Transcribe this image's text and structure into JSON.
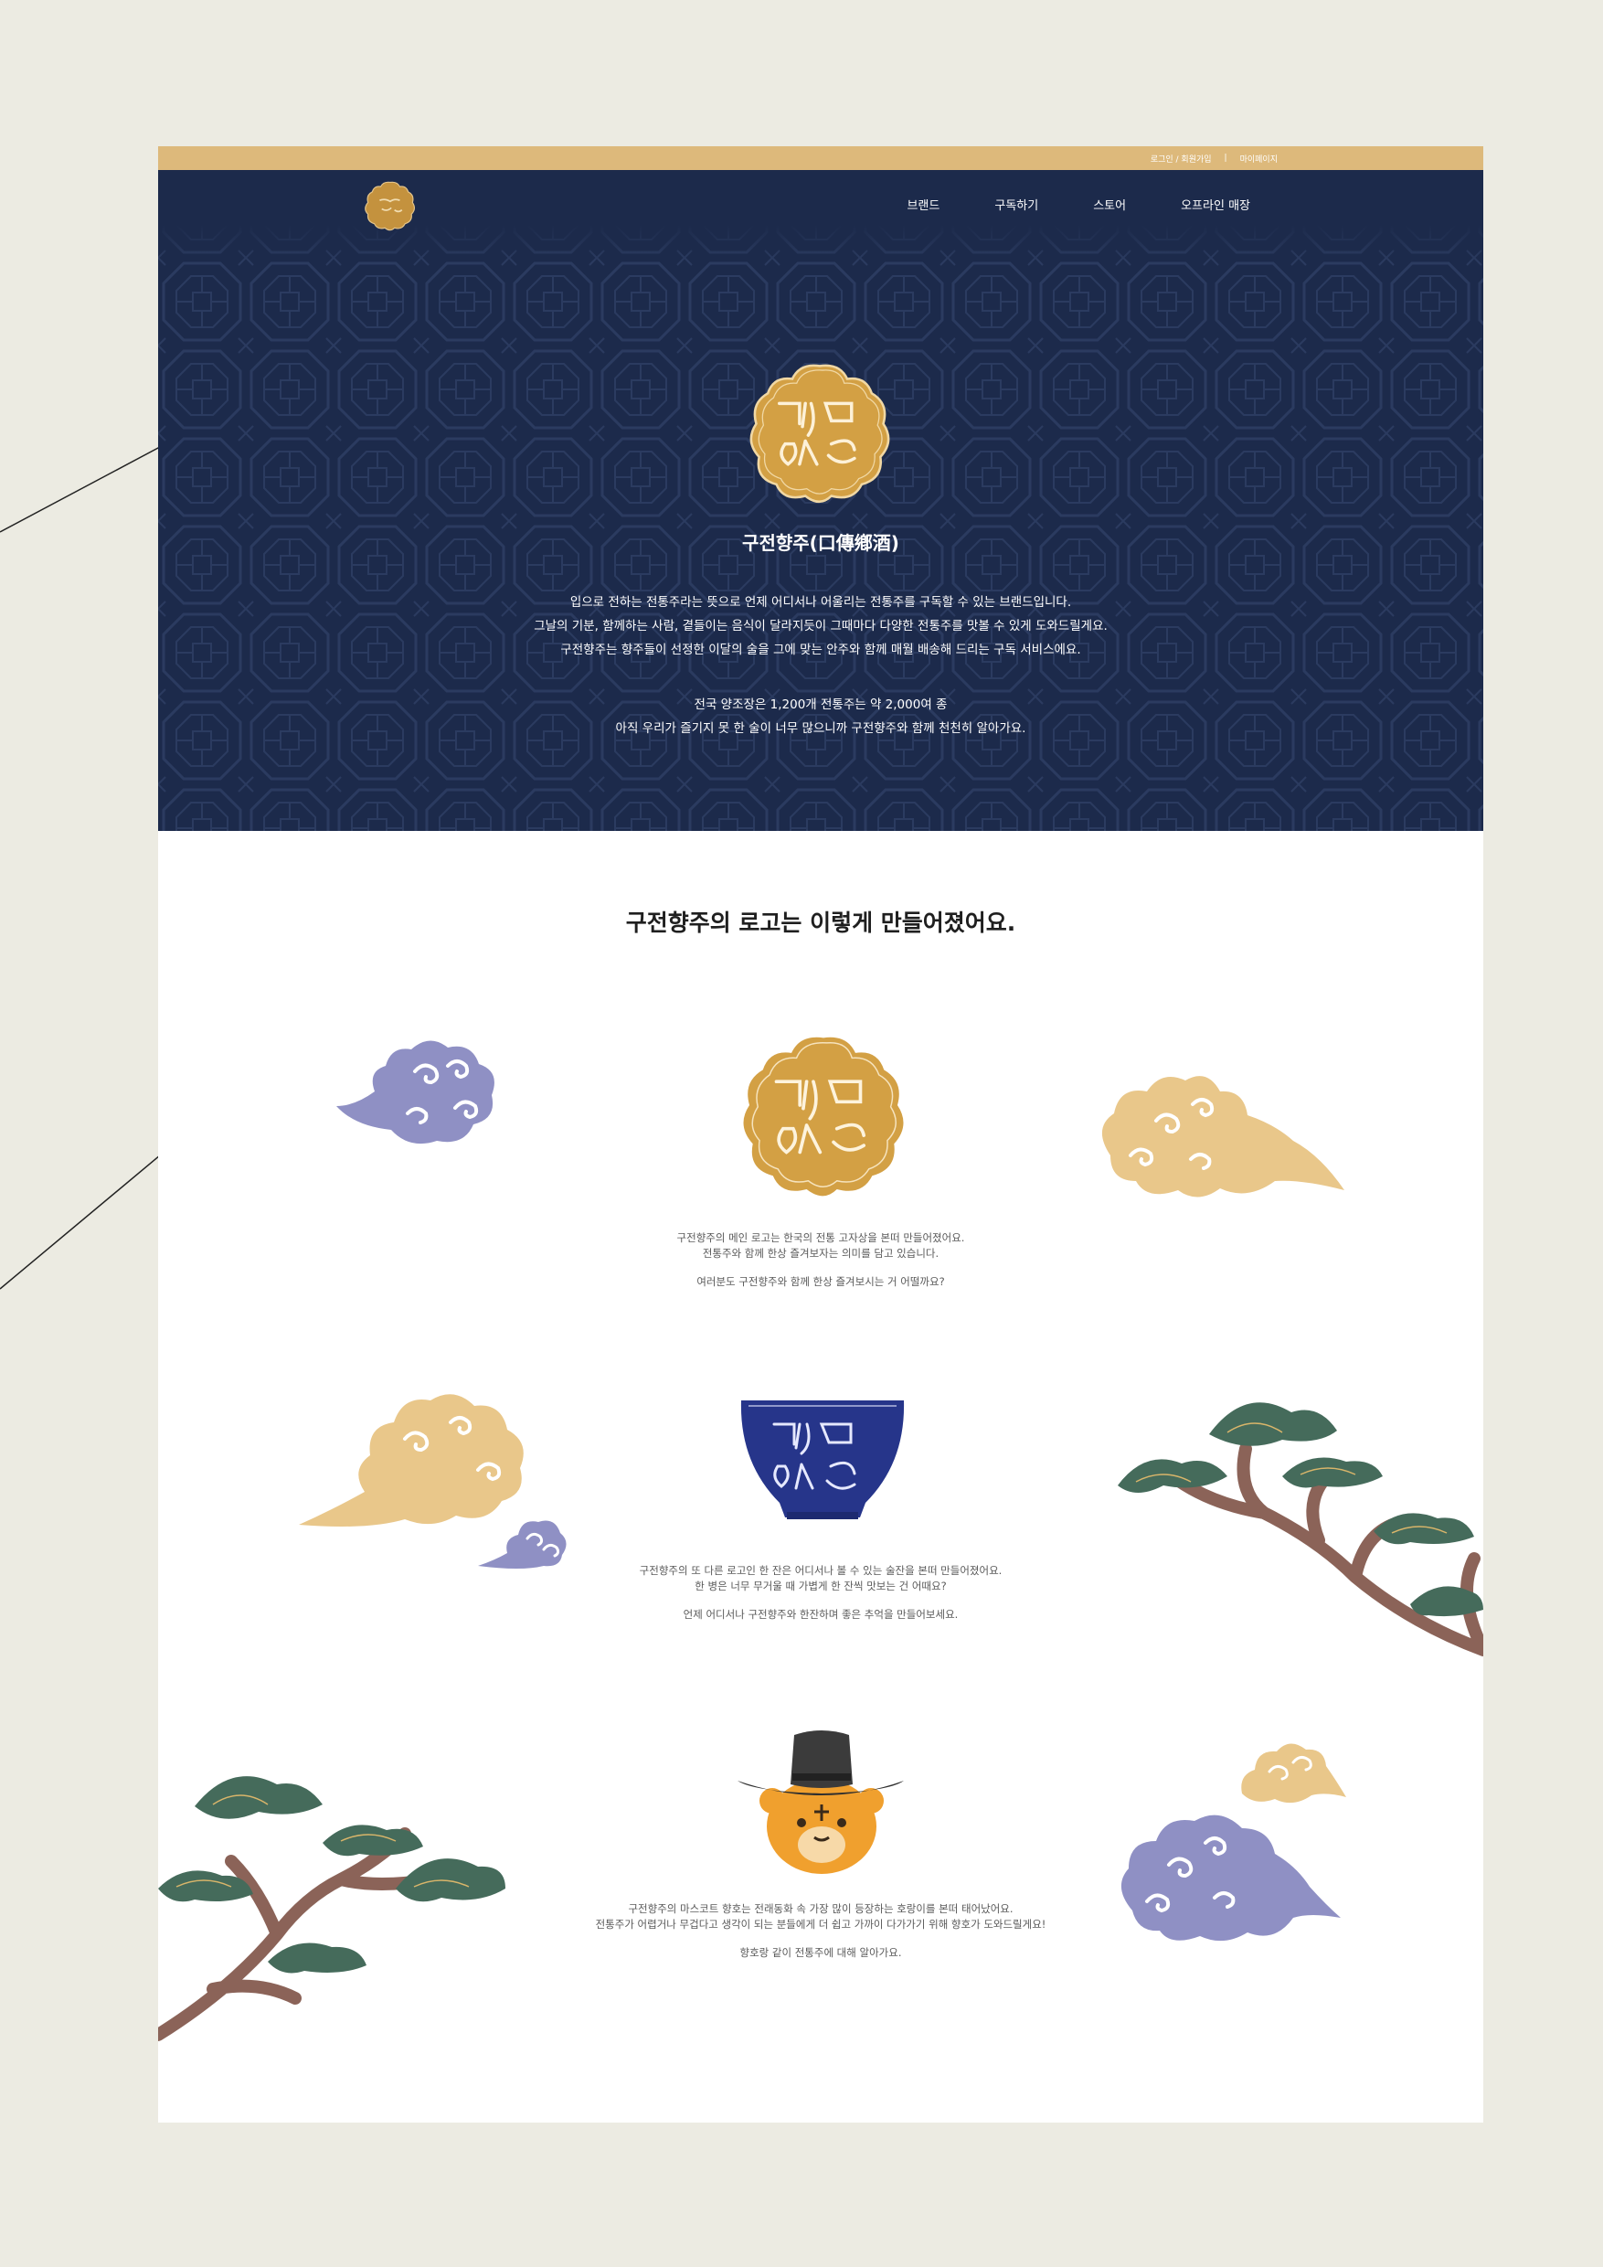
{
  "topbar": {
    "login": "로그인 / 회원가입",
    "separator": "|",
    "mypage": "마이페이지"
  },
  "nav": {
    "items": [
      "브랜드",
      "구독하기",
      "스토어",
      "오프라인 매장"
    ]
  },
  "hero": {
    "title": "구전향주(口傳鄕酒)",
    "desc1": "입으로 전하는 전통주라는 뜻으로 언제 어디서나 어울리는 전통주를 구독할 수 있는 브랜드입니다.",
    "desc2": "그날의 기분, 함께하는 사람, 곁들이는 음식이 달라지듯이 그때마다 다양한 전통주를 맛볼 수 있게 도와드릴게요.",
    "desc3": "구전향주는 향주들이 선정한 이달의 술을 그에 맞는 안주와 함께 매월 배송해 드리는 구독 서비스에요.",
    "desc4": "전국 양조장은 1,200개 전통주는 약 2,000여 종",
    "desc5": "아직 우리가 즐기지 못 한 술이 너무 많으니까 구전향주와 함께 천천히 알아가요."
  },
  "logo_section": {
    "title": "구전향주의 로고는 이렇게 만들어졌어요.",
    "block1": {
      "line1": "구전향주의 메인 로고는 한국의 전통 고자상을 본떠 만들어졌어요.",
      "line2": "전통주와 함께 한상 즐겨보자는 의미를 담고 있습니다.",
      "line3": "여러분도 구전향주와 함께 한상 즐겨보시는 거 어떨까요?"
    },
    "block2": {
      "line1": "구전향주의 또 다른 로고인 한 잔은 어디서나 볼 수 있는 술잔을 본떠 만들어졌어요.",
      "line2": "한 병은 너무 무거울 때 가볍게 한 잔씩 맛보는 건 어때요?",
      "line3": "언제 어디서나 구전향주와 한잔하며 좋은 추억을 만들어보세요."
    },
    "block3": {
      "line1": "구전향주의 마스코트 향호는 전래동화 속 가장 많이 등장하는 호랑이를 본떠 태어났어요.",
      "line2": "전통주가 어렵거나 무겁다고 생각이 되는 분들에게 더 쉽고 가까이 다가가기 위해 향호가 도와드릴게요!",
      "line3": "향호랑 같이 전통주에 대해 알아가요."
    }
  },
  "colors": {
    "navy": "#1c2a4b",
    "gold": "#ddb97b",
    "logo_gold": "#d3a044",
    "cloud_purple": "#8f90c4",
    "cloud_yellow": "#e9c78a",
    "pine_green": "#456b5b",
    "pine_trunk": "#8b6358",
    "background": "#ecebe2"
  },
  "icons": [
    "logo-icon",
    "cup-logo-icon",
    "tiger-mascot-icon",
    "cloud-icon",
    "pine-tree-icon"
  ]
}
